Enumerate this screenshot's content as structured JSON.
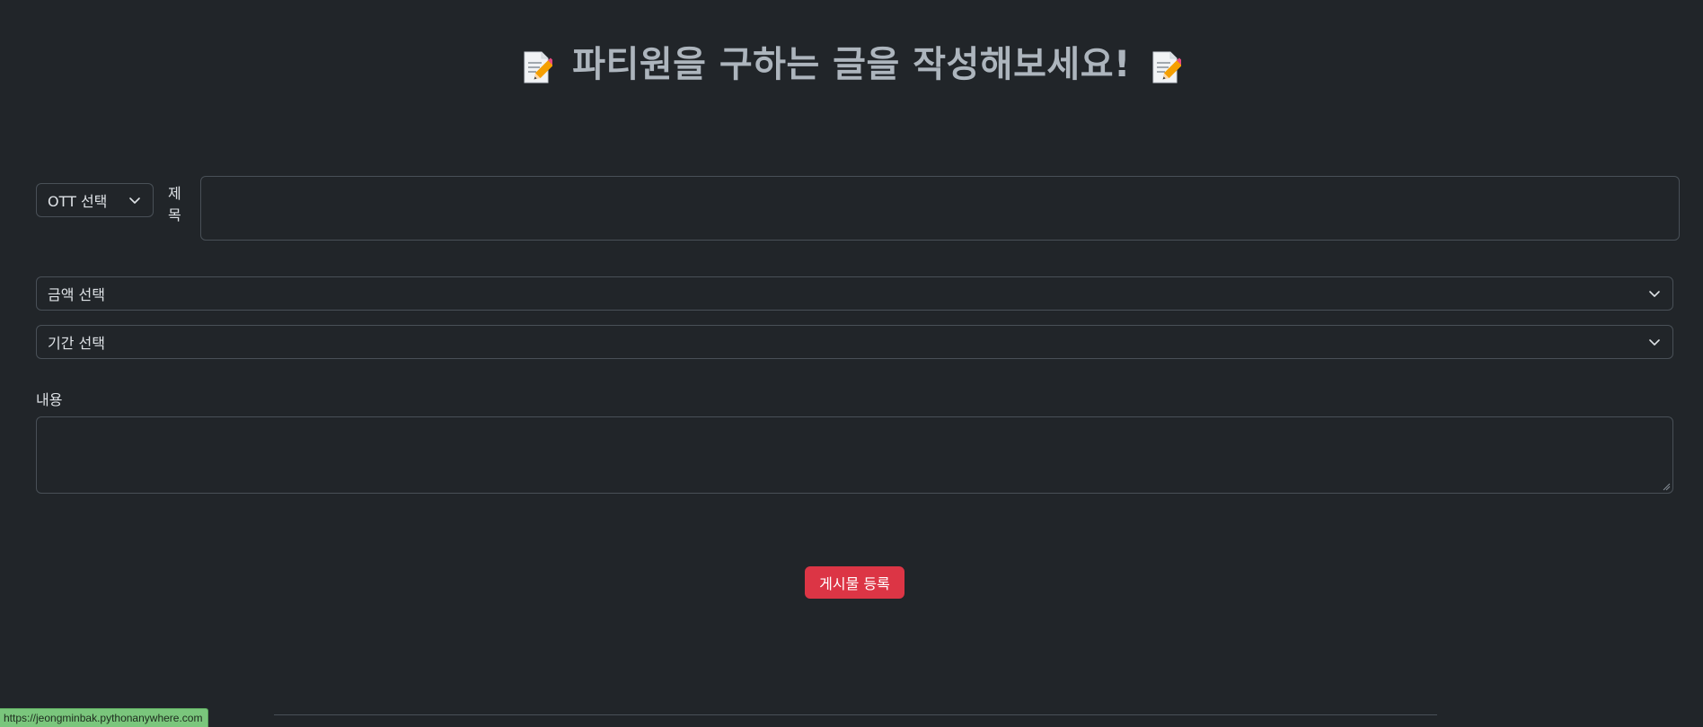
{
  "page": {
    "title": "파티원을 구하는 글을 작성해보세요!",
    "title_icon": "memo-icon"
  },
  "form": {
    "ott_select": {
      "selected": "OTT 선택"
    },
    "title_label": "제\n목",
    "title_input_value": "",
    "price_select": {
      "selected": "금액 선택"
    },
    "period_select": {
      "selected": "기간 선택"
    },
    "content_label": "내용",
    "content_value": "",
    "submit_label": "게시물 등록"
  },
  "status_bar": {
    "url": "https://jeongminbak.pythonanywhere.com"
  },
  "colors": {
    "background": "#212529",
    "border": "#495057",
    "text": "#dee2e6",
    "title": "#adb5bd",
    "button": "#dc3545",
    "status_bg": "#7ac67c"
  }
}
